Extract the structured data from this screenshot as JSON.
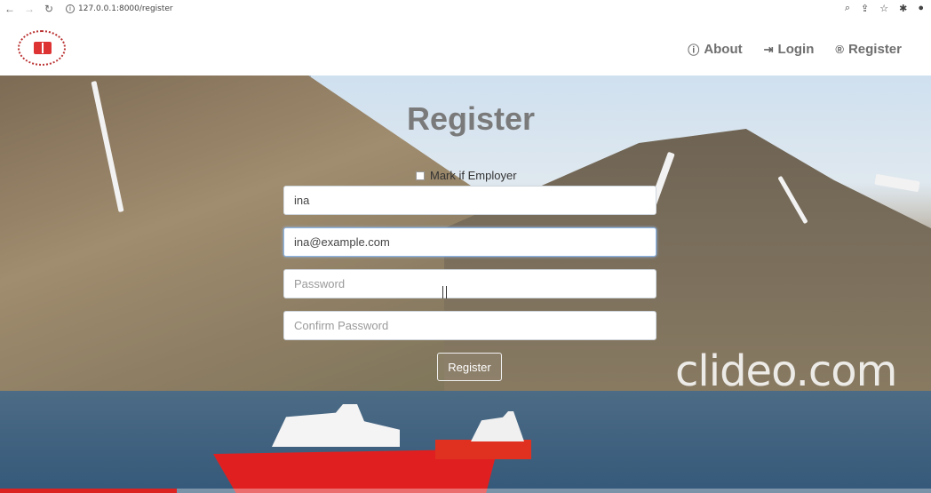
{
  "browser": {
    "url": "127.0.0.1:8000/register",
    "back_icon": "arrow-left-icon",
    "forward_icon": "arrow-right-icon",
    "reload_icon": "reload-icon"
  },
  "nav": {
    "about": "About",
    "login": "Login",
    "register": "Register"
  },
  "form": {
    "title": "Register",
    "employer_label": "Mark if Employer",
    "username_value": "ina",
    "email_value": "ina@example.com",
    "password_placeholder": "Password",
    "confirm_placeholder": "Confirm Password",
    "submit_label": "Register"
  },
  "watermark": "clideo.com",
  "video_progress": 0.19,
  "colors": {
    "nav_text": "#6f6f6f",
    "title_text": "#7a7a7a",
    "ship_red": "#e02020",
    "progress_red": "#dd2222"
  }
}
